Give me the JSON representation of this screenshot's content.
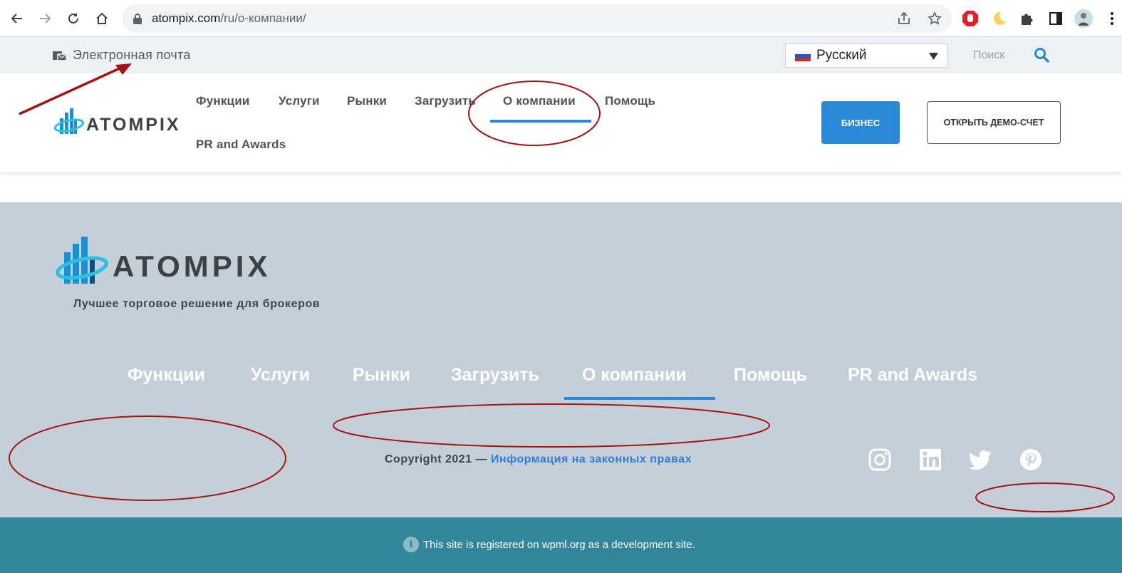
{
  "browser": {
    "url_domain": "atompix.com",
    "url_path": "/ru/о-компании/"
  },
  "top_strip": {
    "email_label": "Электронная почта",
    "language": "Русский",
    "search_placeholder": "Поиск"
  },
  "header": {
    "nav": [
      "Функции",
      "Услуги",
      "Рынки",
      "Загрузить",
      "О компании",
      "Помощь",
      "PR and Awards"
    ],
    "active_nav": "О компании",
    "btn_business": "БИЗНЕС",
    "btn_demo": "ОТКРЫТЬ ДЕМО-СЧЕТ",
    "logo_text": "ATOMPIX"
  },
  "footer": {
    "logo_text": "ATOMPIX",
    "tagline": "Лучшее торговое решение для брокеров",
    "nav": [
      "Функции",
      "Услуги",
      "Рынки",
      "Загрузить",
      "О компании",
      "Помощь",
      "PR and Awards"
    ],
    "copyright_prefix": "Copyright 2021 — ",
    "copyright_link": "Информация на законных правах",
    "social_icons": [
      "instagram-icon",
      "linkedin-icon",
      "twitter-icon",
      "pinterest-icon"
    ]
  },
  "dev_banner": {
    "text": "This site is registered on wpml.org as a development site."
  },
  "colors": {
    "accent": "#2b88d8",
    "footer_bg": "#c4cfd8",
    "banner_bg": "#31869c",
    "annotation": "#a31515"
  }
}
